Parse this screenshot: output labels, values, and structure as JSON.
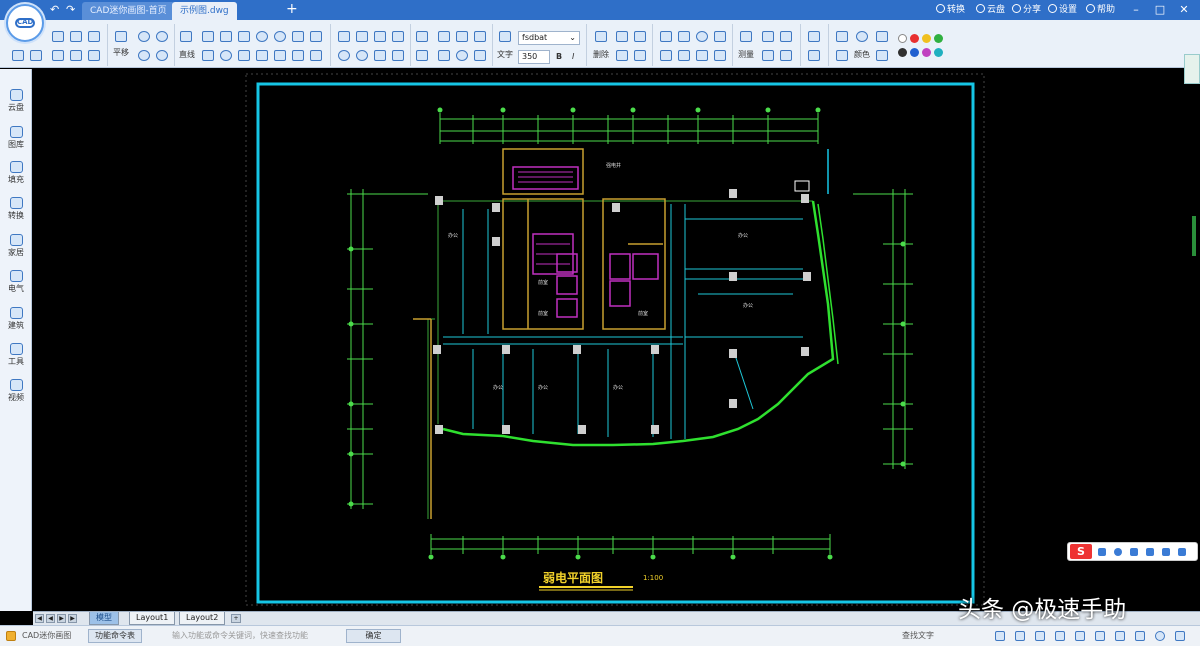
{
  "app": {
    "logo_text": "CAD"
  },
  "tabs": [
    {
      "label": "CAD迷你画图-首页"
    },
    {
      "label": "示例图.dwg"
    }
  ],
  "top_links": [
    {
      "label": "转换"
    },
    {
      "label": "云盘"
    },
    {
      "label": "分享"
    },
    {
      "label": "设置"
    },
    {
      "label": "帮助"
    }
  ],
  "window_controls": {
    "minimize": "–",
    "maximize": "□",
    "close": "✕"
  },
  "ribbon": {
    "pan_label": "平移",
    "line_label": "直线",
    "text_label": "文字",
    "font_value": "fsdbat",
    "size_value": "350",
    "bold": "B",
    "italic": "I",
    "delete_label": "删除",
    "measure_label": "测量",
    "color_label": "颜色",
    "colors": [
      "#ffffff",
      "#e83030",
      "#f0c020",
      "#30b040",
      "#303030",
      "#2060d0",
      "#c040c0",
      "#20b0c0"
    ]
  },
  "sidebar": {
    "items": [
      {
        "label": "云盘",
        "icon": "cloud-icon"
      },
      {
        "label": "图库",
        "icon": "folder-icon"
      },
      {
        "label": "填充",
        "icon": "fill-icon"
      },
      {
        "label": "转换",
        "icon": "convert-icon"
      },
      {
        "label": "家居",
        "icon": "home-icon"
      },
      {
        "label": "电气",
        "icon": "electric-icon"
      },
      {
        "label": "建筑",
        "icon": "building-icon"
      },
      {
        "label": "工具",
        "icon": "tools-icon"
      },
      {
        "label": "视频",
        "icon": "video-icon"
      }
    ]
  },
  "drawing": {
    "title": "弱电平面图",
    "scale": "1:100"
  },
  "layout_tabs": [
    {
      "label": "模型"
    },
    {
      "label": "Layout1"
    },
    {
      "label": "Layout2"
    }
  ],
  "status": {
    "app_name": "CAD迷你画图",
    "cmd_button": "功能命令表",
    "hint": "输入功能或命令关键词，快速查找功能",
    "confirm_button": "确定",
    "find_text": "查找文字"
  },
  "watermark": "头条 @极速手助"
}
